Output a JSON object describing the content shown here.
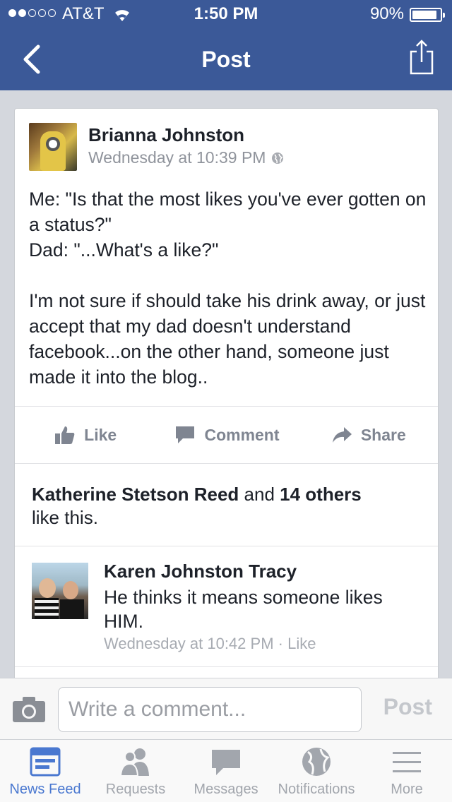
{
  "status_bar": {
    "carrier": "AT&T",
    "time": "1:50 PM",
    "battery": "90%",
    "battery_level": 0.9,
    "signal_bars": 2,
    "signal_total": 5
  },
  "nav": {
    "title": "Post",
    "back_icon": "chevron-left-icon",
    "share_icon": "share-icon"
  },
  "post": {
    "author": "Brianna Johnston",
    "timestamp": "Wednesday at 10:39 PM",
    "privacy_icon": "globe-icon",
    "text": "Me: \"Is that the most likes you've ever gotten on a status?\"\nDad: \"...What's a like?\"\n\nI'm not sure if  should take his drink away, or just accept that my dad doesn't understand facebook...on the other hand, someone just made it into the blog..",
    "actions": {
      "like": "Like",
      "comment": "Comment",
      "share": "Share"
    },
    "likes": {
      "name": "Katherine Stetson Reed",
      "and": "and",
      "others": "14 others",
      "suffix": "like this."
    }
  },
  "comment": {
    "author": "Karen Johnston Tracy",
    "text": "He thinks it means someone likes HIM.",
    "timestamp": "Wednesday at 10:42 PM",
    "separator": "·",
    "like_label": "Like"
  },
  "composer": {
    "placeholder": "Write a comment...",
    "post_label": "Post",
    "camera_icon": "camera-icon"
  },
  "tabs": [
    {
      "label": "News Feed",
      "icon": "news-feed-icon",
      "active": true
    },
    {
      "label": "Requests",
      "icon": "friends-icon",
      "active": false
    },
    {
      "label": "Messages",
      "icon": "messages-icon",
      "active": false
    },
    {
      "label": "Notifications",
      "icon": "globe-icon",
      "active": false
    },
    {
      "label": "More",
      "icon": "menu-icon",
      "active": false
    }
  ],
  "colors": {
    "brand": "#3b5998",
    "active_tab": "#4a78d0",
    "muted": "#90949c"
  }
}
